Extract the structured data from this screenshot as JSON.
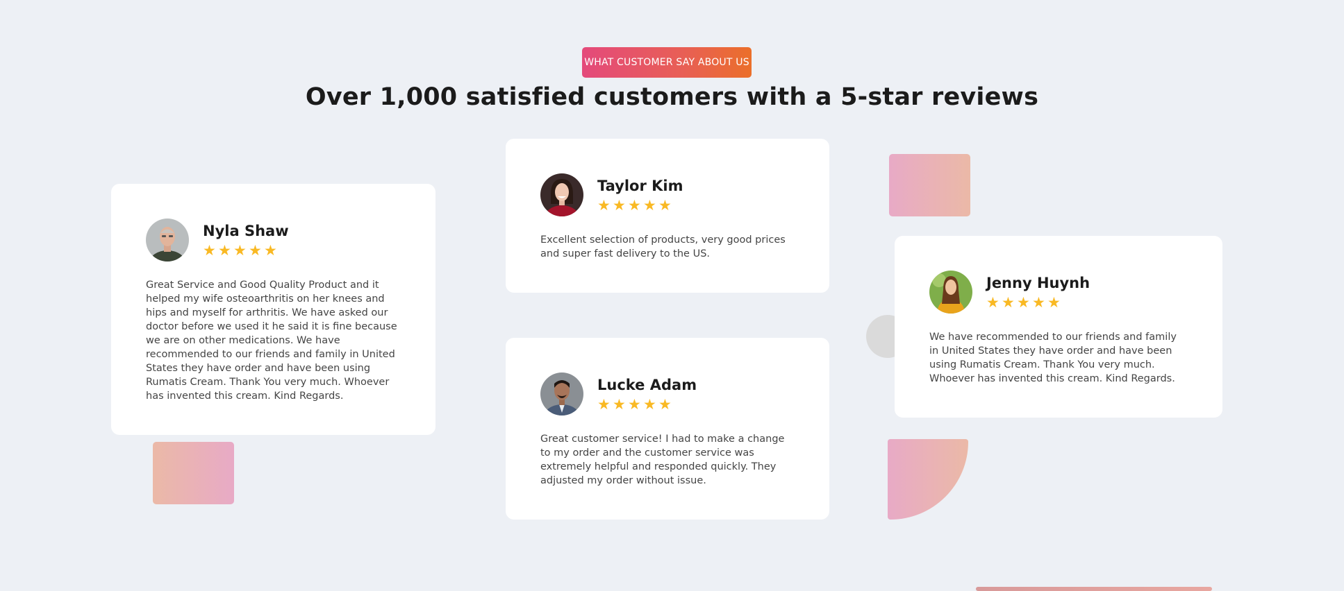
{
  "section": {
    "badge": "WHAT CUSTOMER SAY ABOUT US",
    "title": "Over 1,000 satisfied customers with a 5-star reviews"
  },
  "star_glyph": "★",
  "reviews": [
    {
      "name": "Nyla Shaw",
      "rating": 5,
      "text": "Great Service and Good Quality Product and it helped my wife osteoarthritis on her knees and hips and myself for arthritis. We have asked our doctor before we used it he said it is fine because we are on other medications. We have recommended to our friends and family in United States they have order and have been using Rumatis Cream. Thank You very much. Whoever has invented this cream. Kind Regards."
    },
    {
      "name": "Taylor Kim",
      "rating": 5,
      "text": "Excellent selection of products, very good prices and super fast delivery to the US."
    },
    {
      "name": "Lucke Adam",
      "rating": 5,
      "text": "Great customer service! I had to make a change to my order and the customer service was extremely helpful and responded quickly. They adjusted my order without issue."
    },
    {
      "name": "Jenny Huynh",
      "rating": 5,
      "text": "We have recommended to our friends and family in United States they have order and have been using Rumatis Cream. Thank You very much. Whoever has invented this cream. Kind Regards."
    }
  ],
  "colors": {
    "background": "#edf0f5",
    "badge_gradient_start": "#e44a7b",
    "badge_gradient_end": "#eb6f2a",
    "star": "#f9b924",
    "card": "#ffffff"
  }
}
